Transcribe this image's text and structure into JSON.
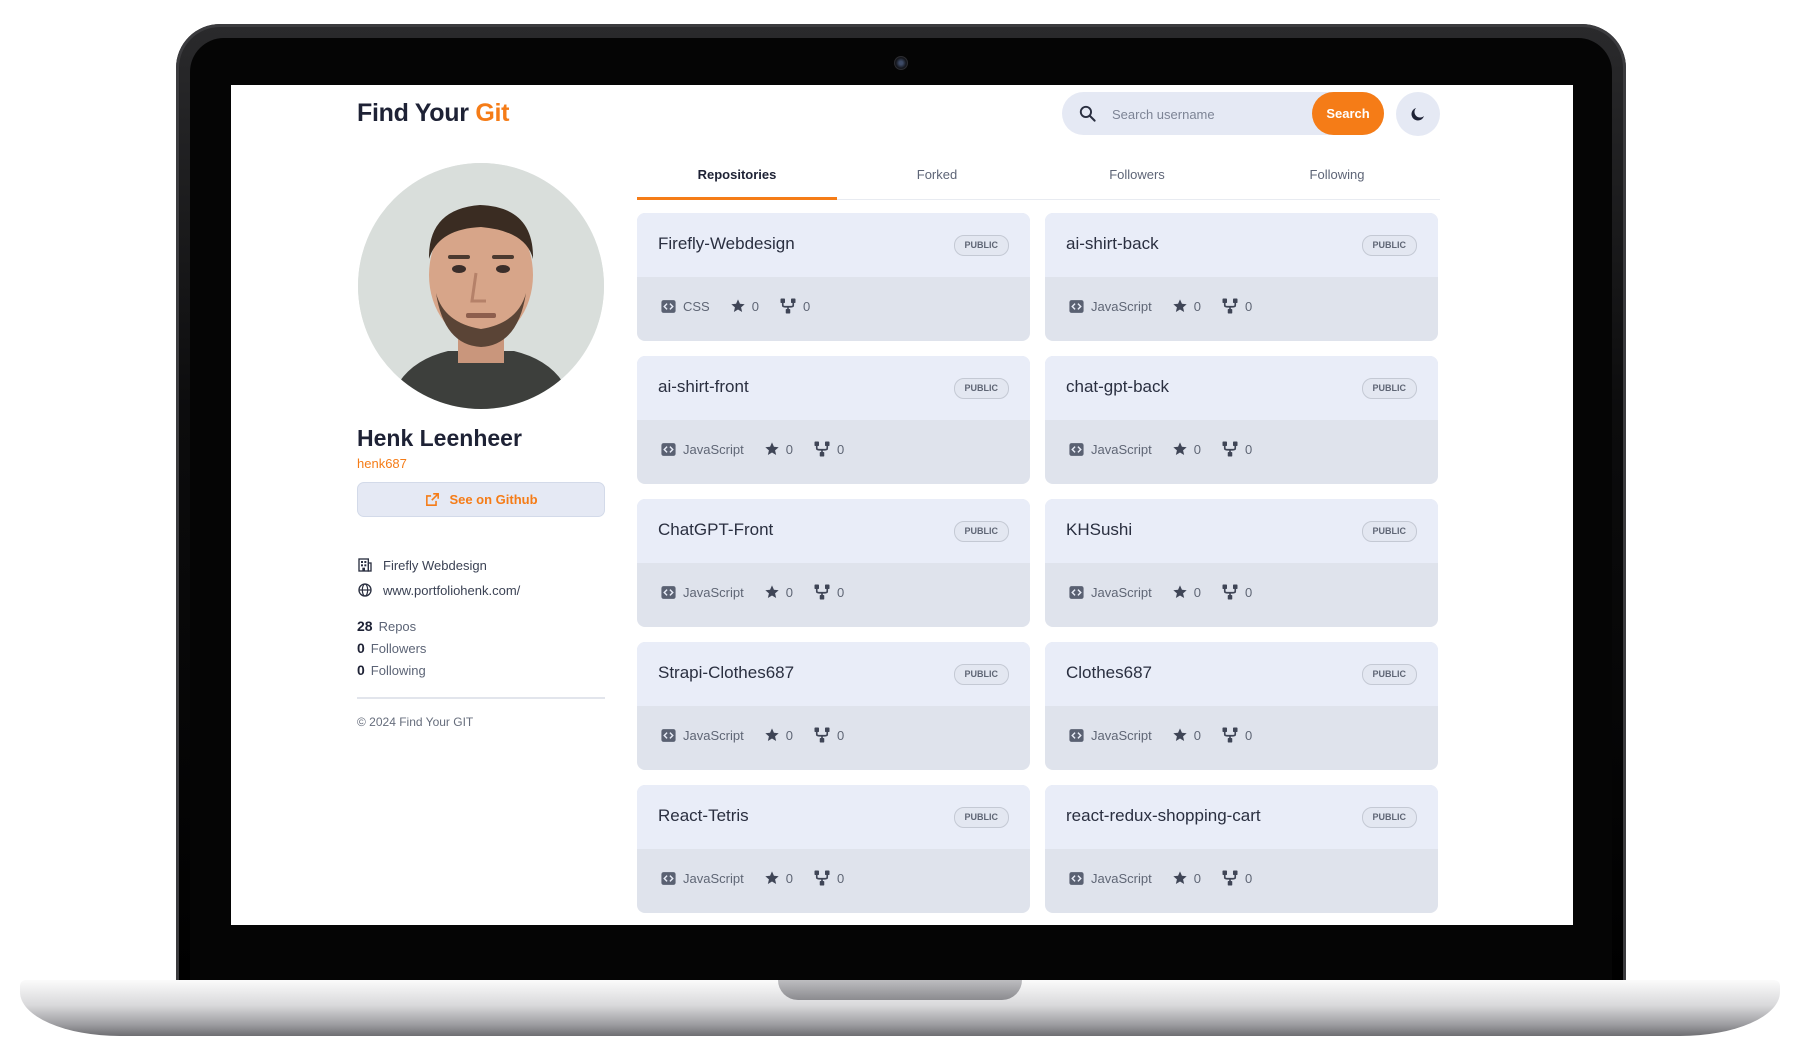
{
  "brand": {
    "title_prefix": "Find Your",
    "title_accent": "Git"
  },
  "search": {
    "placeholder": "Search username",
    "value": "",
    "button_label": "Search"
  },
  "theme_toggle": {
    "icon": "moon-icon"
  },
  "profile": {
    "name": "Henk Leenheer",
    "login": "henk687",
    "github_button_label": "See on Github",
    "company": "Firefly Webdesign",
    "website": "www.portfoliohenk.com/",
    "stats": [
      {
        "count": "28",
        "label": "Repos"
      },
      {
        "count": "0",
        "label": "Followers"
      },
      {
        "count": "0",
        "label": "Following"
      }
    ],
    "footer": "© 2024 Find Your GIT"
  },
  "tabs": [
    {
      "label": "Repositories",
      "active": true
    },
    {
      "label": "Forked",
      "active": false
    },
    {
      "label": "Followers",
      "active": false
    },
    {
      "label": "Following",
      "active": false
    }
  ],
  "repos": [
    {
      "name": "Firefly-Webdesign",
      "visibility": "PUBLIC",
      "language": "CSS",
      "stars": "0",
      "forks": "0"
    },
    {
      "name": "ai-shirt-back",
      "visibility": "PUBLIC",
      "language": "JavaScript",
      "stars": "0",
      "forks": "0"
    },
    {
      "name": "ai-shirt-front",
      "visibility": "PUBLIC",
      "language": "JavaScript",
      "stars": "0",
      "forks": "0"
    },
    {
      "name": "chat-gpt-back",
      "visibility": "PUBLIC",
      "language": "JavaScript",
      "stars": "0",
      "forks": "0"
    },
    {
      "name": "ChatGPT-Front",
      "visibility": "PUBLIC",
      "language": "JavaScript",
      "stars": "0",
      "forks": "0"
    },
    {
      "name": "KHSushi",
      "visibility": "PUBLIC",
      "language": "JavaScript",
      "stars": "0",
      "forks": "0"
    },
    {
      "name": "Strapi-Clothes687",
      "visibility": "PUBLIC",
      "language": "JavaScript",
      "stars": "0",
      "forks": "0"
    },
    {
      "name": "Clothes687",
      "visibility": "PUBLIC",
      "language": "JavaScript",
      "stars": "0",
      "forks": "0"
    },
    {
      "name": "React-Tetris",
      "visibility": "PUBLIC",
      "language": "JavaScript",
      "stars": "0",
      "forks": "0"
    },
    {
      "name": "react-redux-shopping-cart",
      "visibility": "PUBLIC",
      "language": "JavaScript",
      "stars": "0",
      "forks": "0"
    }
  ],
  "colors": {
    "accent": "#f57c17",
    "card_top": "#e9edf8",
    "card_bottom": "#dfe3ec",
    "text_dark": "#1e2235"
  }
}
